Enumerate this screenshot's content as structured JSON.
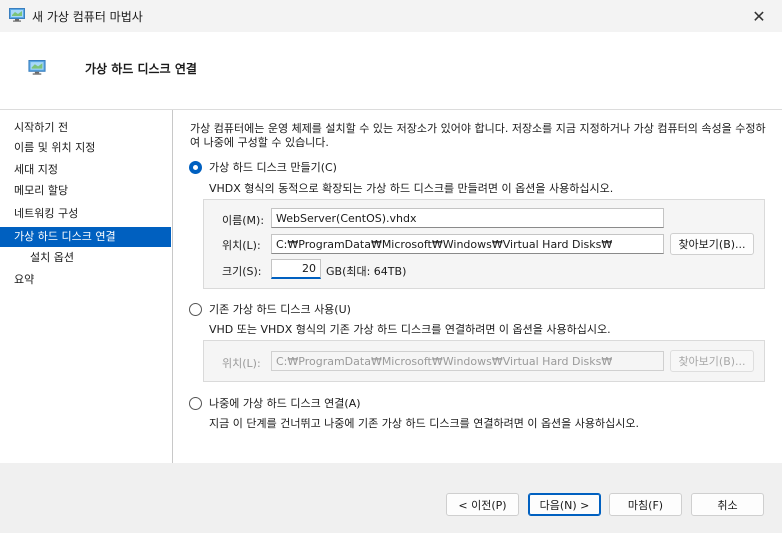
{
  "window": {
    "title": "새 가상 컴퓨터 마법사",
    "close_glyph": "✕"
  },
  "header": {
    "title": "가상 하드 디스크 연결",
    "icon": "monitor-icon"
  },
  "nav": {
    "items": [
      {
        "label": "시작하기 전",
        "active": false
      },
      {
        "label": "이름 및 위치 지정",
        "active": false
      },
      {
        "label": "세대 지정",
        "active": false
      },
      {
        "label": "메모리 할당",
        "active": false
      },
      {
        "label": "네트워킹 구성",
        "active": false
      },
      {
        "label": "가상 하드 디스크 연결",
        "active": true
      },
      {
        "label": "설치 옵션",
        "active": false,
        "sub": true
      },
      {
        "label": "요약",
        "active": false
      }
    ]
  },
  "content": {
    "intro": "가상 컴퓨터에는 운영 체제를 설치할 수 있는 저장소가 있어야 합니다. 저장소를 지금 지정하거나 가상 컴퓨터의 속성을 수정하여 나중에 구성할 수 있습니다.",
    "option_create": {
      "label": "가상 하드 디스크 만들기(C)",
      "selected": true,
      "description": "VHDX 형식의 동적으로 확장되는 가상 하드 디스크를 만들려면 이 옵션을 사용하십시오.",
      "name_label": "이름(M):",
      "name_value": "WebServer(CentOS).vhdx",
      "location_label": "위치(L):",
      "location_value": "C:₩ProgramData₩Microsoft₩Windows₩Virtual Hard Disks₩",
      "browse_label": "찾아보기(B)...",
      "size_label": "크기(S):",
      "size_value": "20",
      "size_unit": "GB(최대: 64TB)"
    },
    "option_existing": {
      "label": "기존 가상 하드 디스크 사용(U)",
      "selected": false,
      "description": "VHD 또는 VHDX 형식의 기존 가상 하드 디스크를 연결하려면 이 옵션을 사용하십시오.",
      "location_label": "위치(L):",
      "location_value": "C:₩ProgramData₩Microsoft₩Windows₩Virtual Hard Disks₩",
      "browse_label": "찾아보기(B)..."
    },
    "option_later": {
      "label": "나중에 가상 하드 디스크 연결(A)",
      "selected": false,
      "description": "지금 이 단계를 건너뛰고 나중에 기존 가상 하드 디스크를 연결하려면 이 옵션을 사용하십시오."
    }
  },
  "footer": {
    "prev_label": "< 이전(P)",
    "next_label": "다음(N) >",
    "finish_label": "마침(F)",
    "cancel_label": "취소"
  },
  "colors": {
    "accent": "#0060c0"
  }
}
